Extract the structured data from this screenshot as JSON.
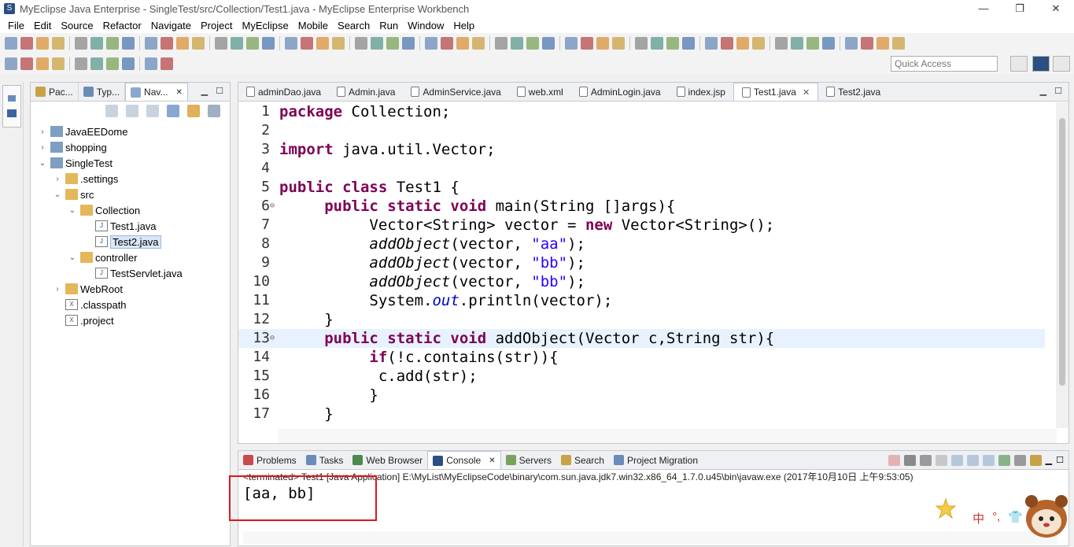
{
  "window": {
    "title": "MyEclipse Java Enterprise - SingleTest/src/Collection/Test1.java - MyEclipse Enterprise Workbench",
    "controls": {
      "minimize": "—",
      "restore": "❐",
      "close": "✕"
    }
  },
  "menu": [
    "File",
    "Edit",
    "Source",
    "Refactor",
    "Navigate",
    "Project",
    "MyEclipse",
    "Mobile",
    "Search",
    "Run",
    "Window",
    "Help"
  ],
  "quick_access": {
    "placeholder": "Quick Access"
  },
  "navigator": {
    "tabs": [
      {
        "label": "Pac...",
        "active": false
      },
      {
        "label": "Typ...",
        "active": false
      },
      {
        "label": "Nav...",
        "active": true
      }
    ],
    "tree": [
      {
        "label": "JavaEEDome",
        "depth": 0,
        "twist": "›",
        "icon": "project"
      },
      {
        "label": "shopping",
        "depth": 0,
        "twist": "›",
        "icon": "project"
      },
      {
        "label": "SingleTest",
        "depth": 0,
        "twist": "⌄",
        "icon": "project"
      },
      {
        "label": ".settings",
        "depth": 1,
        "twist": "›",
        "icon": "folder"
      },
      {
        "label": "src",
        "depth": 1,
        "twist": "⌄",
        "icon": "folder"
      },
      {
        "label": "Collection",
        "depth": 2,
        "twist": "⌄",
        "icon": "folder"
      },
      {
        "label": "Test1.java",
        "depth": 3,
        "twist": "",
        "icon": "jfile"
      },
      {
        "label": "Test2.java",
        "depth": 3,
        "twist": "",
        "icon": "jfile",
        "selected": true
      },
      {
        "label": "controller",
        "depth": 2,
        "twist": "⌄",
        "icon": "folder"
      },
      {
        "label": "TestServlet.java",
        "depth": 3,
        "twist": "",
        "icon": "jfile"
      },
      {
        "label": "WebRoot",
        "depth": 1,
        "twist": "›",
        "icon": "folder"
      },
      {
        "label": ".classpath",
        "depth": 1,
        "twist": "",
        "icon": "xfile"
      },
      {
        "label": ".project",
        "depth": 1,
        "twist": "",
        "icon": "xfile"
      }
    ]
  },
  "editor": {
    "tabs": [
      {
        "label": "adminDao.java",
        "active": false
      },
      {
        "label": "Admin.java",
        "active": false
      },
      {
        "label": "AdminService.java",
        "active": false
      },
      {
        "label": "web.xml",
        "active": false
      },
      {
        "label": "AdminLogin.java",
        "active": false
      },
      {
        "label": "index.jsp",
        "active": false
      },
      {
        "label": "Test1.java",
        "active": true
      },
      {
        "label": "Test2.java",
        "active": false
      }
    ],
    "lines": [
      {
        "n": "1",
        "html": "<span class=\"kw\">package</span> Collection;"
      },
      {
        "n": "2",
        "html": ""
      },
      {
        "n": "3",
        "html": "<span class=\"kw\">import</span> java.util.Vector;"
      },
      {
        "n": "4",
        "html": ""
      },
      {
        "n": "5",
        "html": "<span class=\"kw\">public</span> <span class=\"kw\">class</span> Test1 {"
      },
      {
        "n": "6",
        "html": "     <span class=\"kw\">public</span> <span class=\"kw\">static</span> <span class=\"kw\">void</span> main(String []args){",
        "fold": true
      },
      {
        "n": "7",
        "html": "          Vector&lt;String&gt; vector = <span class=\"kw\">new</span> Vector&lt;String&gt;();"
      },
      {
        "n": "8",
        "html": "          <span class=\"it\">addObject</span>(vector, <span class=\"str\">\"aa\"</span>);"
      },
      {
        "n": "9",
        "html": "          <span class=\"it\">addObject</span>(vector, <span class=\"str\">\"bb\"</span>);"
      },
      {
        "n": "10",
        "html": "          <span class=\"it\">addObject</span>(vector, <span class=\"str\">\"bb\"</span>);"
      },
      {
        "n": "11",
        "html": "          System.<span class=\"fld\">out</span>.println(vector);"
      },
      {
        "n": "12",
        "html": "     }"
      },
      {
        "n": "13",
        "html": "     <span class=\"kw\">public</span> <span class=\"kw\">static</span> <span class=\"kw\">void</span> addObject(Vector c,String str){",
        "fold": true,
        "highlight": true
      },
      {
        "n": "14",
        "html": "          <span class=\"kw\">if</span>(!c.contains(str)){"
      },
      {
        "n": "15",
        "html": "           c.add(str);"
      },
      {
        "n": "16",
        "html": "          }"
      },
      {
        "n": "17",
        "html": "     }"
      }
    ]
  },
  "console": {
    "tabs": [
      {
        "label": "Problems",
        "active": false
      },
      {
        "label": "Tasks",
        "active": false
      },
      {
        "label": "Web Browser",
        "active": false
      },
      {
        "label": "Console",
        "active": true
      },
      {
        "label": "Servers",
        "active": false
      },
      {
        "label": "Search",
        "active": false
      },
      {
        "label": "Project Migration",
        "active": false
      }
    ],
    "terminated": "<terminated> Test1 [Java Application] E:\\MyList\\MyEclipseCode\\binary\\com.sun.java.jdk7.win32.x86_64_1.7.0.u45\\bin\\javaw.exe (2017年10月10日 上午9:53:05)",
    "output": "[aa, bb]"
  },
  "ime": {
    "lang": "中",
    "dot": "°,",
    "shirt": "👕"
  },
  "colors": {
    "keyword": "#7f0055",
    "string": "#2a00ff",
    "highlight_line": "#e8f2fe",
    "annotation_box": "#e0161b"
  }
}
